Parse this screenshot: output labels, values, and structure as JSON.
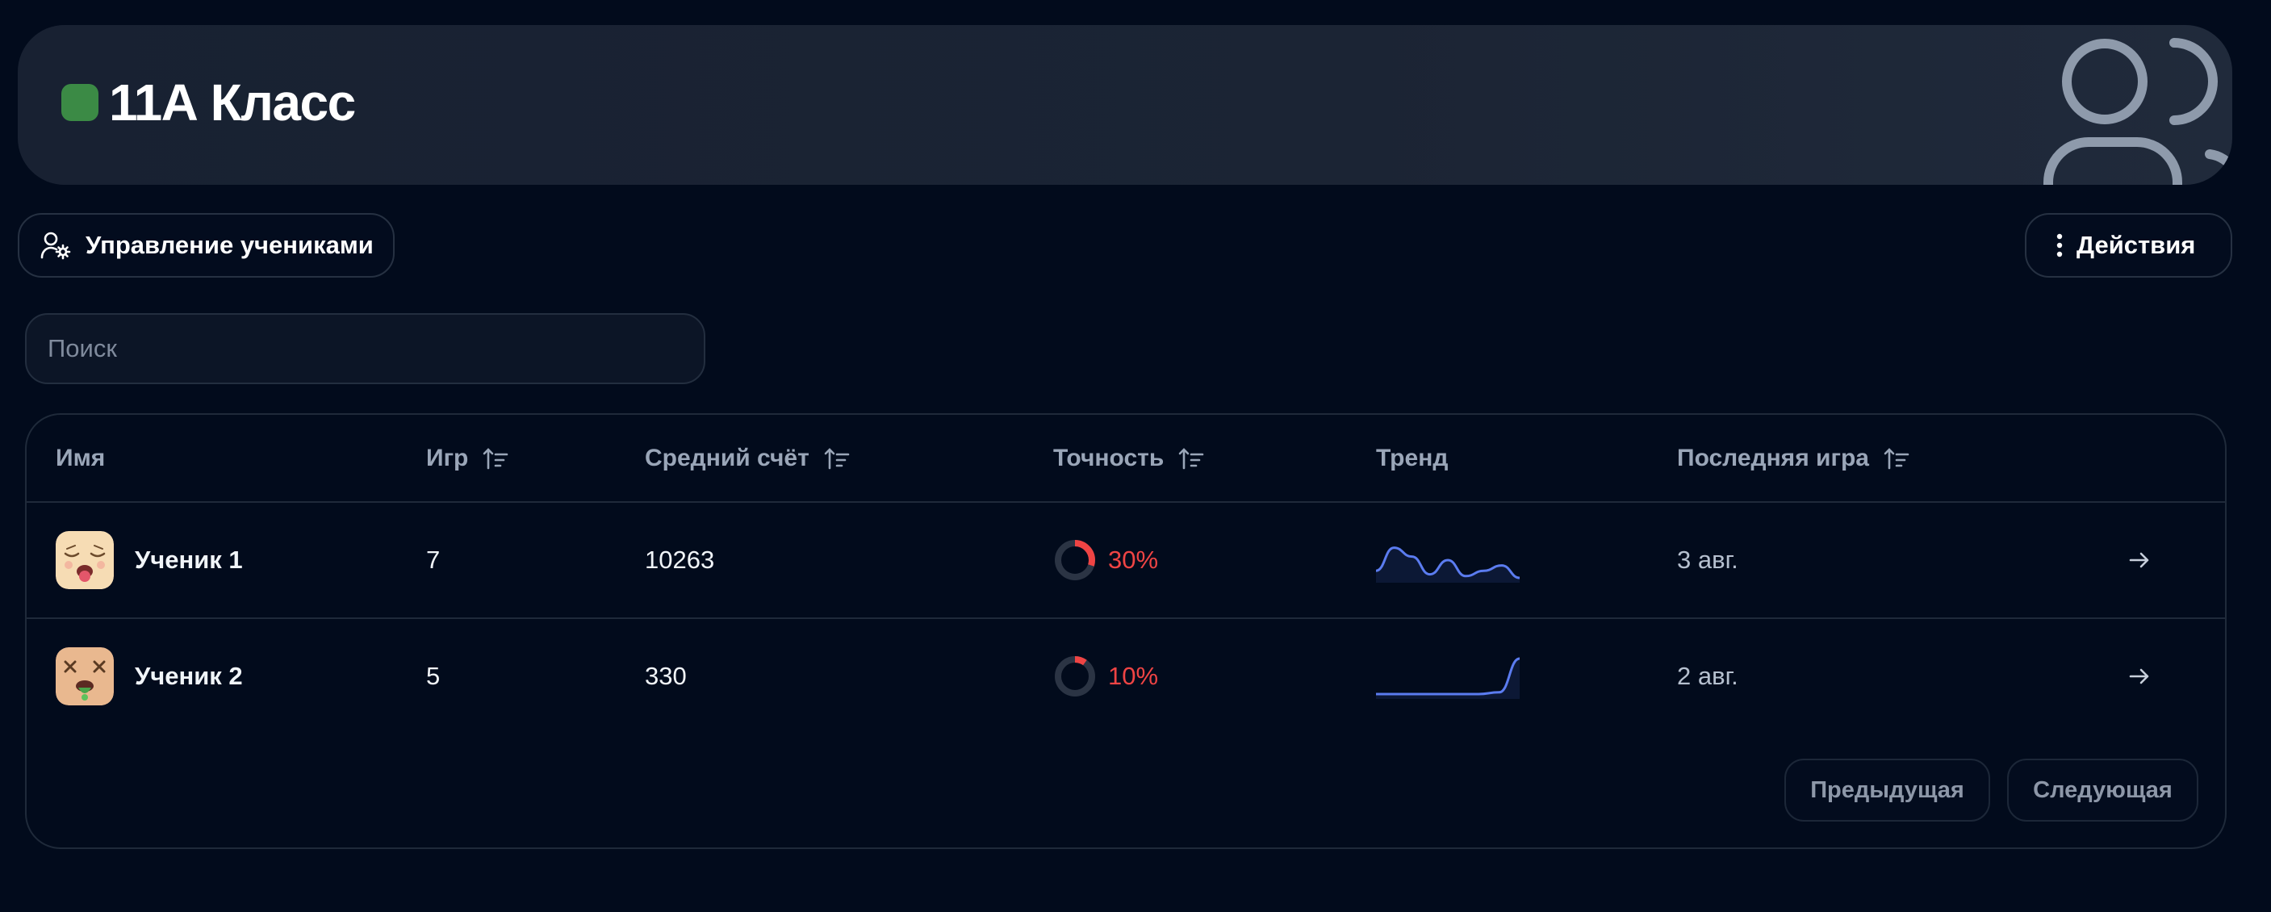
{
  "header": {
    "title": "11А Класс",
    "status_color": "#3b8a45"
  },
  "toolbar": {
    "manage_label": "Управление учениками",
    "actions_label": "Действия"
  },
  "search": {
    "placeholder": "Поиск",
    "value": ""
  },
  "table": {
    "columns": {
      "name": "Имя",
      "games": "Игр",
      "avg_score": "Средний счёт",
      "accuracy": "Точность",
      "trend": "Тренд",
      "last_game": "Последняя игра"
    },
    "rows": [
      {
        "name": "Ученик 1",
        "games": "7",
        "avg_score": "10263",
        "accuracy": "30%",
        "accuracy_value": 0.3,
        "last_game": "3 авг.",
        "avatar": "sleepy-face-avatar",
        "trend": [
          0.2,
          0.85,
          0.6,
          0.1,
          0.5,
          0.05,
          0.2,
          0.35,
          0.0
        ]
      },
      {
        "name": "Ученик 2",
        "games": "5",
        "avg_score": "330",
        "accuracy": "10%",
        "accuracy_value": 0.1,
        "last_game": "2 авг.",
        "avatar": "dizzy-face-avatar",
        "trend": [
          0.0,
          0.0,
          0.0,
          0.0,
          0.0,
          0.0,
          0.05,
          1.0
        ]
      }
    ]
  },
  "pagination": {
    "prev_label": "Предыдущая",
    "next_label": "Следующая"
  },
  "colors": {
    "accuracy": "#ef4444",
    "trend_line": "#5b7cf0",
    "accent": "#3b8a45"
  }
}
